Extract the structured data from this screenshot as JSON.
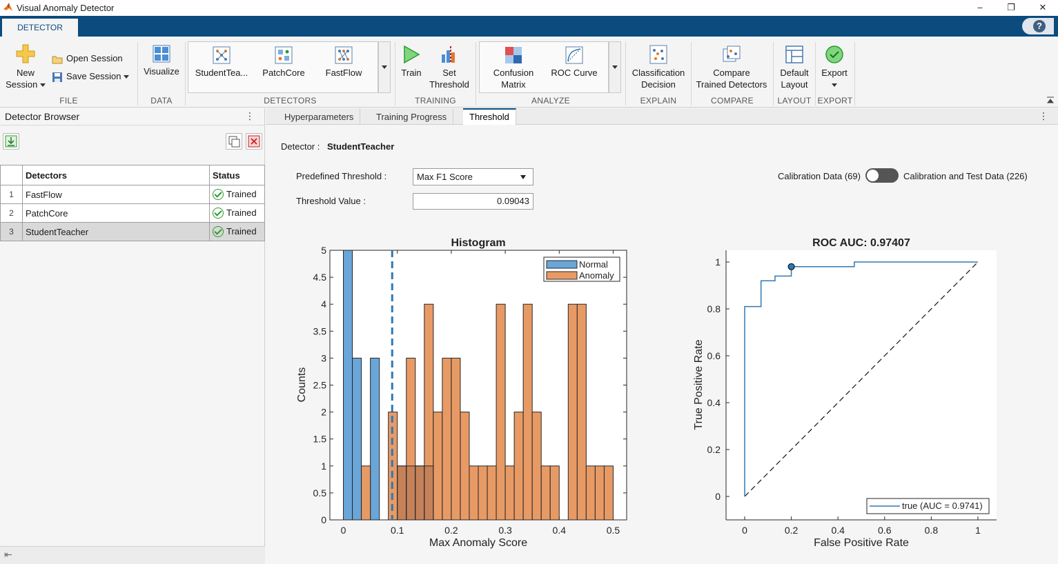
{
  "window": {
    "title": "Visual Anomaly Detector",
    "min": "–",
    "max": "❐",
    "close": "✕"
  },
  "ribbon": {
    "tab": "DETECTOR",
    "help": "?"
  },
  "toolstrip": {
    "file": {
      "new_label_1": "New",
      "new_label_2": "Session",
      "open_session": "Open Session",
      "save_session": "Save Session",
      "section": "FILE"
    },
    "data": {
      "visualize": "Visualize",
      "section": "DATA"
    },
    "detectors": {
      "items": [
        "StudentTea...",
        "PatchCore",
        "FastFlow"
      ],
      "section": "DETECTORS"
    },
    "training": {
      "train": "Train",
      "set_threshold_1": "Set",
      "set_threshold_2": "Threshold",
      "section": "TRAINING"
    },
    "analyze": {
      "confusion_1": "Confusion",
      "confusion_2": "Matrix",
      "roc": "ROC Curve",
      "section": "ANALYZE"
    },
    "explain": {
      "class_1": "Classification",
      "class_2": "Decision",
      "section": "EXPLAIN"
    },
    "compare": {
      "compare_1": "Compare",
      "compare_2": "Trained Detectors",
      "section": "COMPARE"
    },
    "layout": {
      "default_1": "Default",
      "default_2": "Layout",
      "section": "LAYOUT"
    },
    "export": {
      "export": "Export",
      "section": "EXPORT"
    }
  },
  "browser": {
    "title": "Detector Browser",
    "menu": "⋮",
    "columns": [
      "Detectors",
      "Status"
    ],
    "rows": [
      {
        "index": "1",
        "name": "FastFlow",
        "status": "Trained"
      },
      {
        "index": "2",
        "name": "PatchCore",
        "status": "Trained"
      },
      {
        "index": "3",
        "name": "StudentTeacher",
        "status": "Trained"
      }
    ],
    "collapse": "⇤"
  },
  "tabs": [
    "Hyperparameters",
    "Training Progress",
    "Threshold"
  ],
  "tabs_menu": "⋮",
  "threshold": {
    "detector_label": "Detector :",
    "detector_value": "StudentTeacher",
    "predefined_label": "Predefined Threshold :",
    "predefined_value": "Max F1 Score",
    "value_label": "Threshold Value :",
    "value": "0.09043",
    "calib_left": "Calibration Data (69)",
    "calib_right": "Calibration and Test Data (226)"
  },
  "colors": {
    "normal": "#6aa6d8",
    "anomaly": "#e89a65",
    "overlap": "#a87050",
    "line": "#2e78b6",
    "brand": "#0b4b7e"
  },
  "chart_data": [
    {
      "type": "bar",
      "title": "Histogram",
      "xlabel": "Max Anomaly Score",
      "ylabel": "Counts",
      "xlim": [
        -0.025,
        0.525
      ],
      "ylim": [
        0,
        5
      ],
      "xticks": [
        "0",
        "0.1",
        "0.2",
        "0.3",
        "0.4",
        "0.5"
      ],
      "yticks": [
        "0",
        "0.5",
        "1",
        "1.5",
        "2",
        "2.5",
        "3",
        "3.5",
        "4",
        "4.5",
        "5"
      ],
      "bin_width": 0.01667,
      "threshold": 0.09043,
      "legend": [
        "Normal",
        "Anomaly"
      ],
      "legend_position": "top-right",
      "series": [
        {
          "name": "Normal",
          "bin_starts": [
            0.0,
            0.01667,
            0.05
          ],
          "values": [
            5,
            3,
            3
          ]
        },
        {
          "name": "Anomaly",
          "bin_starts": [
            0.03333,
            0.08333,
            0.1,
            0.11667,
            0.13333,
            0.15,
            0.16667,
            0.18333,
            0.2,
            0.21667,
            0.23333,
            0.25,
            0.26667,
            0.28333,
            0.3,
            0.31667,
            0.33333,
            0.35,
            0.36667,
            0.38333,
            0.41667,
            0.43333,
            0.45,
            0.46667,
            0.48333
          ],
          "values": [
            1,
            2,
            1,
            3,
            1,
            4,
            2,
            3,
            3,
            2,
            1,
            1,
            1,
            4,
            1,
            2,
            4,
            2,
            1,
            1,
            4,
            4,
            1,
            1,
            1
          ]
        }
      ]
    },
    {
      "type": "line",
      "title": "ROC AUC: 0.97407",
      "xlabel": "False Positive Rate",
      "ylabel": "True Positive Rate",
      "xlim": [
        -0.08,
        1.08
      ],
      "ylim": [
        -0.1,
        1.05
      ],
      "xticks": [
        "0",
        "0.2",
        "0.4",
        "0.6",
        "0.8",
        "1"
      ],
      "yticks": [
        "0",
        "0.2",
        "0.4",
        "0.6",
        "0.8",
        "1"
      ],
      "legend": [
        "true (AUC = 0.9741)"
      ],
      "legend_position": "bottom-right",
      "series": [
        {
          "name": "true (AUC = 0.9741)",
          "x": [
            0,
            0,
            0.07,
            0.07,
            0.13,
            0.13,
            0.2,
            0.2,
            0.47,
            0.47,
            1.0
          ],
          "y": [
            0,
            0.81,
            0.81,
            0.92,
            0.92,
            0.94,
            0.94,
            0.98,
            0.98,
            1.0,
            1.0
          ]
        }
      ],
      "diagonal": [
        [
          0,
          0
        ],
        [
          1,
          1
        ]
      ],
      "operating_point": [
        0.2,
        0.98
      ]
    }
  ]
}
